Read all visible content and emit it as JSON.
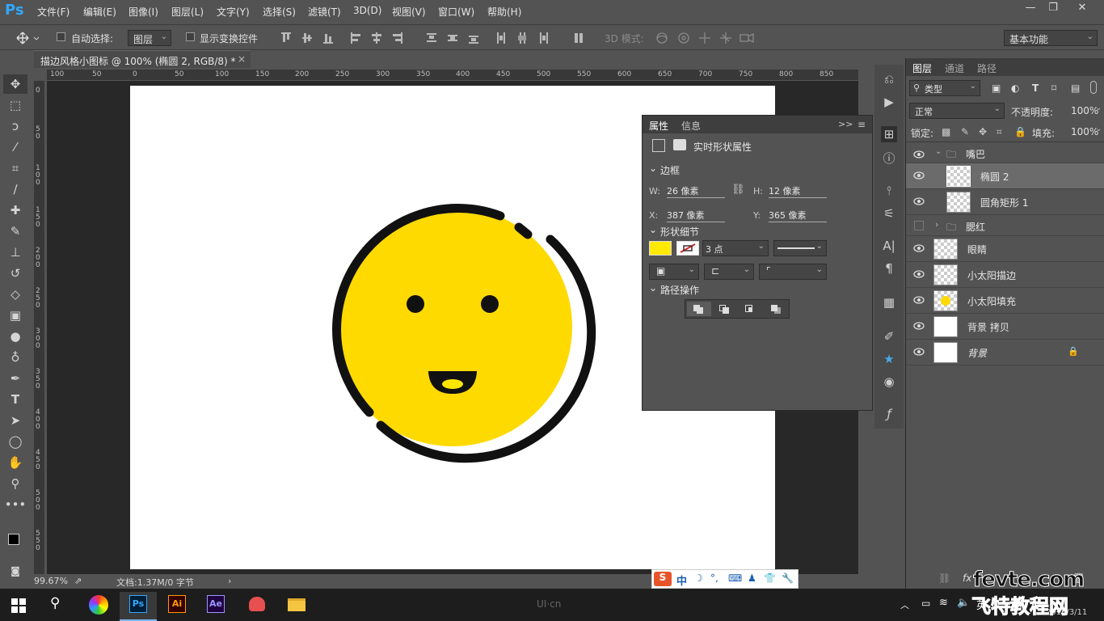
{
  "app": {
    "logo": "Ps"
  },
  "menu": [
    "文件(F)",
    "编辑(E)",
    "图像(I)",
    "图层(L)",
    "文字(Y)",
    "选择(S)",
    "滤镜(T)",
    "3D(D)",
    "视图(V)",
    "窗口(W)",
    "帮助(H)"
  ],
  "window_controls": {
    "minimize": "—",
    "restore": "❐",
    "close": "✕"
  },
  "options": {
    "auto_select_label": "自动选择:",
    "auto_select_value": "图层",
    "show_transform_label": "显示变换控件",
    "mode_3d_label": "3D 模式:",
    "workspace": "基本功能"
  },
  "document": {
    "tab_title": "描边风格小图标 @ 100% (椭圆 2, RGB/8) *",
    "close": "×",
    "zoom": "99.67%",
    "doc_info": "文档:1.37M/0 字节",
    "status_arrow": "›"
  },
  "ruler": {
    "top_ticks": [
      "100",
      "50",
      "0",
      "50",
      "100",
      "150",
      "200",
      "250",
      "300",
      "350",
      "400",
      "450",
      "500",
      "550",
      "600",
      "650",
      "700",
      "750",
      "800",
      "850"
    ],
    "left_ticks": [
      "0",
      "50",
      "100",
      "150",
      "200",
      "250",
      "300",
      "350",
      "400",
      "450",
      "500",
      "550"
    ]
  },
  "properties": {
    "tabs": [
      "属性",
      "信息"
    ],
    "active_tab": "属性",
    "collapse": ">>",
    "type_label": "实时形状属性",
    "bounds_section": "边框",
    "w_label": "W:",
    "w_value": "26 像素",
    "h_label": "H:",
    "h_value": "12 像素",
    "x_label": "X:",
    "x_value": "387 像素",
    "y_label": "Y:",
    "y_value": "365 像素",
    "shape_section": "形状细节",
    "fill_color": "#ffea00",
    "stroke_width": "3 点",
    "path_section": "路径操作"
  },
  "layers": {
    "tabs": [
      "图层",
      "通道",
      "路径"
    ],
    "active_tab": "图层",
    "filter_label": "类型",
    "blend_mode": "正常",
    "opacity_label": "不透明度:",
    "opacity_value": "100%",
    "lock_label": "锁定:",
    "fill_label": "填充:",
    "fill_value": "100%",
    "items": [
      {
        "name": "嘴巴",
        "kind": "group",
        "visible": true,
        "expanded": true
      },
      {
        "name": "椭圆 2",
        "kind": "shape",
        "visible": true,
        "selected": true
      },
      {
        "name": "圆角矩形 1",
        "kind": "shape",
        "visible": true
      },
      {
        "name": "腮红",
        "kind": "group",
        "visible": false,
        "expanded": false
      },
      {
        "name": "眼睛",
        "kind": "shape",
        "visible": true
      },
      {
        "name": "小太阳描边",
        "kind": "shape",
        "visible": true
      },
      {
        "name": "小太阳填充",
        "kind": "shape",
        "visible": true
      },
      {
        "name": "背景 拷贝",
        "kind": "pixel",
        "visible": true
      },
      {
        "name": "背景",
        "kind": "pixel",
        "visible": true,
        "locked": true
      }
    ]
  },
  "ime": {
    "lang": "中"
  },
  "watermark": {
    "site": "fevte.com",
    "cn_name": "飞特教程网",
    "date": "2016/3/11",
    "uicn": "UI·cn"
  },
  "colors": {
    "accent_ps": "#31a8ff",
    "sun_fill": "#ffda00",
    "stroke": "#111111",
    "mouth_inner": "#ffe600"
  }
}
